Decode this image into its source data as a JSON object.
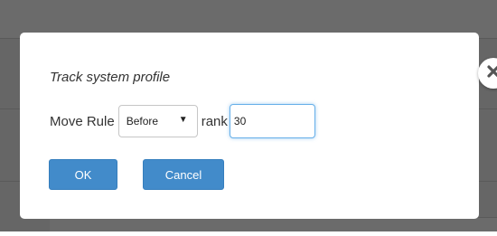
{
  "dialog": {
    "title": "Track system profile",
    "move_rule_label": "Move Rule",
    "position_select": {
      "value": "Before",
      "arrow": "▼"
    },
    "rank_label": "rank",
    "rank_input": {
      "value": "30"
    },
    "ok_label": "OK",
    "cancel_label": "Cancel",
    "close_icon": "close-icon"
  },
  "colors": {
    "primary_button": "#428bca",
    "focus_border": "#66afe9"
  }
}
